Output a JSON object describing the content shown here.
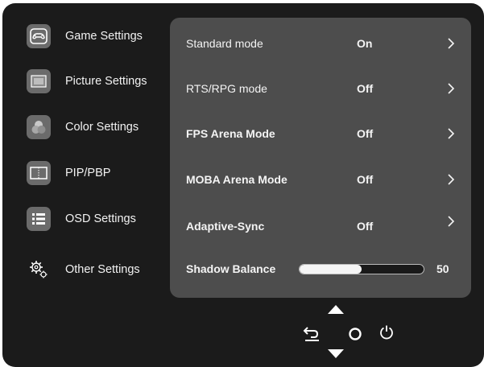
{
  "sidebar": {
    "items": [
      {
        "label": "Game Settings",
        "icon": "gamepad-icon"
      },
      {
        "label": "Picture Settings",
        "icon": "picture-icon"
      },
      {
        "label": "Color Settings",
        "icon": "color-drop-icon"
      },
      {
        "label": "PIP/PBP",
        "icon": "pip-window-icon"
      },
      {
        "label": "OSD Settings",
        "icon": "osd-menu-icon"
      },
      {
        "label": "Other Settings",
        "icon": "gear-icon"
      }
    ]
  },
  "panel": {
    "rows": [
      {
        "label": "Standard mode",
        "value": "On"
      },
      {
        "label": "RTS/RPG mode",
        "value": "Off"
      },
      {
        "label": "FPS Arena Mode",
        "value": "Off"
      },
      {
        "label": "MOBA Arena Mode",
        "value": "Off"
      },
      {
        "label": "Adaptive-Sync",
        "value": "Off"
      }
    ],
    "slider": {
      "label": "Shadow Balance",
      "value": "50",
      "level": 50
    }
  },
  "colors": {
    "background": "#1b1b1b",
    "panel": "#4d4d4d",
    "icon_bg": "#6b6b6b",
    "text": "#f4f4f4"
  }
}
